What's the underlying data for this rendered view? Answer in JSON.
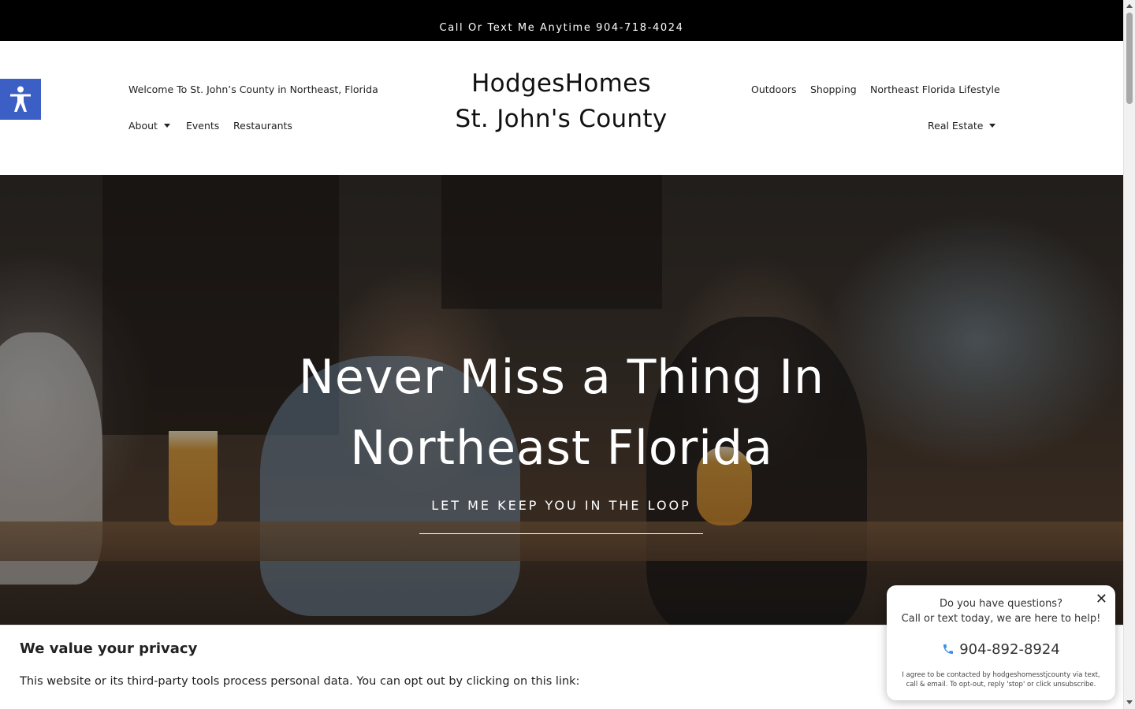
{
  "topbar": {
    "text": "Call Or Text Me Anytime 904-718-4024"
  },
  "header": {
    "tagline": "Welcome To St. John’s County in Northeast, Florida",
    "logo_line1": "HodgesHomes",
    "logo_line2": "St. John's County",
    "left_nav": [
      {
        "label": "About",
        "has_dropdown": true
      },
      {
        "label": "Events",
        "has_dropdown": false
      },
      {
        "label": "Restaurants",
        "has_dropdown": false
      }
    ],
    "right_nav_top": [
      {
        "label": "Outdoors"
      },
      {
        "label": "Shopping"
      },
      {
        "label": "Northeast Florida Lifestyle"
      }
    ],
    "right_nav_bottom": [
      {
        "label": "Real Estate",
        "has_dropdown": true
      }
    ]
  },
  "accessibility": {
    "icon": "accessibility-person-icon",
    "color": "#3b5fc4"
  },
  "hero": {
    "title_line1": "Never Miss a Thing In",
    "title_line2": "Northeast Florida",
    "cta": "LET ME KEEP YOU IN THE LOOP"
  },
  "privacy": {
    "title": "We value your privacy",
    "text": "This website or its third-party tools process personal data. You can opt out by clicking on this link:"
  },
  "chat": {
    "line1": "Do you have questions?",
    "line2": "Call or text today, we are here to help!",
    "phone": "904-892-8924",
    "fine_print": "I agree to be contacted by hodgeshomesstjcounty via text, call & email. To opt-out, reply 'stop' or click unsubscribe.",
    "close_icon": "close-icon",
    "phone_icon_color": "#3a8ee6"
  }
}
